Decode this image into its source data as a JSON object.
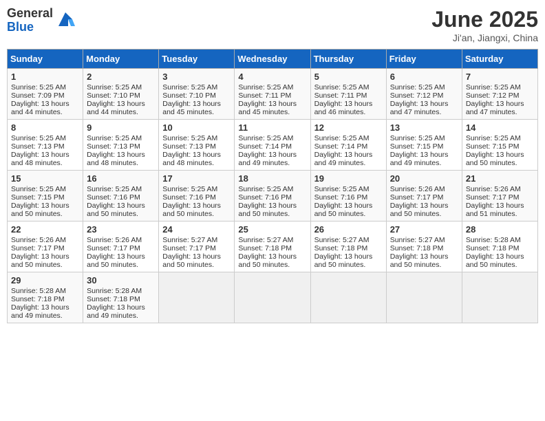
{
  "logo": {
    "general": "General",
    "blue": "Blue"
  },
  "title": {
    "month": "June 2025",
    "location": "Ji'an, Jiangxi, China"
  },
  "days_header": [
    "Sunday",
    "Monday",
    "Tuesday",
    "Wednesday",
    "Thursday",
    "Friday",
    "Saturday"
  ],
  "weeks": [
    [
      {
        "day": "1",
        "sunrise": "5:25 AM",
        "sunset": "7:09 PM",
        "daylight": "13 hours and 44 minutes."
      },
      {
        "day": "2",
        "sunrise": "5:25 AM",
        "sunset": "7:10 PM",
        "daylight": "13 hours and 44 minutes."
      },
      {
        "day": "3",
        "sunrise": "5:25 AM",
        "sunset": "7:10 PM",
        "daylight": "13 hours and 45 minutes."
      },
      {
        "day": "4",
        "sunrise": "5:25 AM",
        "sunset": "7:11 PM",
        "daylight": "13 hours and 45 minutes."
      },
      {
        "day": "5",
        "sunrise": "5:25 AM",
        "sunset": "7:11 PM",
        "daylight": "13 hours and 46 minutes."
      },
      {
        "day": "6",
        "sunrise": "5:25 AM",
        "sunset": "7:12 PM",
        "daylight": "13 hours and 47 minutes."
      },
      {
        "day": "7",
        "sunrise": "5:25 AM",
        "sunset": "7:12 PM",
        "daylight": "13 hours and 47 minutes."
      }
    ],
    [
      {
        "day": "8",
        "sunrise": "5:25 AM",
        "sunset": "7:13 PM",
        "daylight": "13 hours and 48 minutes."
      },
      {
        "day": "9",
        "sunrise": "5:25 AM",
        "sunset": "7:13 PM",
        "daylight": "13 hours and 48 minutes."
      },
      {
        "day": "10",
        "sunrise": "5:25 AM",
        "sunset": "7:13 PM",
        "daylight": "13 hours and 48 minutes."
      },
      {
        "day": "11",
        "sunrise": "5:25 AM",
        "sunset": "7:14 PM",
        "daylight": "13 hours and 49 minutes."
      },
      {
        "day": "12",
        "sunrise": "5:25 AM",
        "sunset": "7:14 PM",
        "daylight": "13 hours and 49 minutes."
      },
      {
        "day": "13",
        "sunrise": "5:25 AM",
        "sunset": "7:15 PM",
        "daylight": "13 hours and 49 minutes."
      },
      {
        "day": "14",
        "sunrise": "5:25 AM",
        "sunset": "7:15 PM",
        "daylight": "13 hours and 50 minutes."
      }
    ],
    [
      {
        "day": "15",
        "sunrise": "5:25 AM",
        "sunset": "7:15 PM",
        "daylight": "13 hours and 50 minutes."
      },
      {
        "day": "16",
        "sunrise": "5:25 AM",
        "sunset": "7:16 PM",
        "daylight": "13 hours and 50 minutes."
      },
      {
        "day": "17",
        "sunrise": "5:25 AM",
        "sunset": "7:16 PM",
        "daylight": "13 hours and 50 minutes."
      },
      {
        "day": "18",
        "sunrise": "5:25 AM",
        "sunset": "7:16 PM",
        "daylight": "13 hours and 50 minutes."
      },
      {
        "day": "19",
        "sunrise": "5:25 AM",
        "sunset": "7:16 PM",
        "daylight": "13 hours and 50 minutes."
      },
      {
        "day": "20",
        "sunrise": "5:26 AM",
        "sunset": "7:17 PM",
        "daylight": "13 hours and 50 minutes."
      },
      {
        "day": "21",
        "sunrise": "5:26 AM",
        "sunset": "7:17 PM",
        "daylight": "13 hours and 51 minutes."
      }
    ],
    [
      {
        "day": "22",
        "sunrise": "5:26 AM",
        "sunset": "7:17 PM",
        "daylight": "13 hours and 50 minutes."
      },
      {
        "day": "23",
        "sunrise": "5:26 AM",
        "sunset": "7:17 PM",
        "daylight": "13 hours and 50 minutes."
      },
      {
        "day": "24",
        "sunrise": "5:27 AM",
        "sunset": "7:17 PM",
        "daylight": "13 hours and 50 minutes."
      },
      {
        "day": "25",
        "sunrise": "5:27 AM",
        "sunset": "7:18 PM",
        "daylight": "13 hours and 50 minutes."
      },
      {
        "day": "26",
        "sunrise": "5:27 AM",
        "sunset": "7:18 PM",
        "daylight": "13 hours and 50 minutes."
      },
      {
        "day": "27",
        "sunrise": "5:27 AM",
        "sunset": "7:18 PM",
        "daylight": "13 hours and 50 minutes."
      },
      {
        "day": "28",
        "sunrise": "5:28 AM",
        "sunset": "7:18 PM",
        "daylight": "13 hours and 50 minutes."
      }
    ],
    [
      {
        "day": "29",
        "sunrise": "5:28 AM",
        "sunset": "7:18 PM",
        "daylight": "13 hours and 49 minutes."
      },
      {
        "day": "30",
        "sunrise": "5:28 AM",
        "sunset": "7:18 PM",
        "daylight": "13 hours and 49 minutes."
      },
      null,
      null,
      null,
      null,
      null
    ]
  ],
  "labels": {
    "sunrise": "Sunrise:",
    "sunset": "Sunset:",
    "daylight": "Daylight:"
  }
}
